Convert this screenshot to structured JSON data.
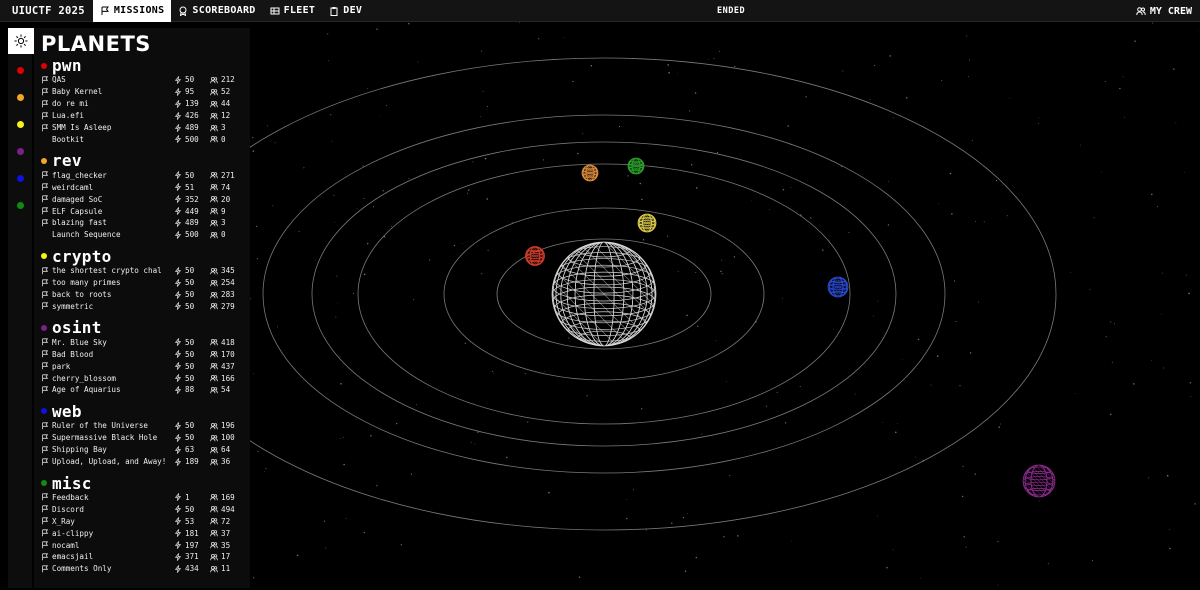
{
  "topbar": {
    "brand": "UIUCTF 2025",
    "nav": [
      {
        "label": "MISSIONS",
        "icon": "flag-icon",
        "active": true
      },
      {
        "label": "SCOREBOARD",
        "icon": "badge-icon",
        "active": false
      },
      {
        "label": "FLEET",
        "icon": "grid-icon",
        "active": false
      },
      {
        "label": "DEV",
        "icon": "clipboard-icon",
        "active": false
      }
    ],
    "status": "ENDED",
    "crew_label": "MY CREW"
  },
  "rail": {
    "toggle_icon": "sun-icon",
    "category_dots": [
      "#e00000",
      "#f5a623",
      "#f7f21a",
      "#7d1f8a",
      "#1010e0",
      "#128a12"
    ]
  },
  "panel": {
    "title": "PLANETS",
    "categories": [
      {
        "name": "pwn",
        "color": "#e00000",
        "challenges": [
          {
            "name": "QAS",
            "points": "50",
            "solves": "212",
            "flag": true
          },
          {
            "name": "Baby Kernel",
            "points": "95",
            "solves": "52",
            "flag": true
          },
          {
            "name": "do re mi",
            "points": "139",
            "solves": "44",
            "flag": true
          },
          {
            "name": "Lua.efi",
            "points": "426",
            "solves": "12",
            "flag": true
          },
          {
            "name": "SMM Is Asleep",
            "points": "489",
            "solves": "3",
            "flag": true
          },
          {
            "name": "Bootkit",
            "points": "500",
            "solves": "0",
            "flag": false
          }
        ]
      },
      {
        "name": "rev",
        "color": "#f5a623",
        "challenges": [
          {
            "name": "flag_checker",
            "points": "50",
            "solves": "271",
            "flag": true
          },
          {
            "name": "weirdcaml",
            "points": "51",
            "solves": "74",
            "flag": true
          },
          {
            "name": "damaged SoC",
            "points": "352",
            "solves": "20",
            "flag": true
          },
          {
            "name": "ELF Capsule",
            "points": "449",
            "solves": "9",
            "flag": true
          },
          {
            "name": "blazing fast",
            "points": "489",
            "solves": "3",
            "flag": true
          },
          {
            "name": "Launch Sequence",
            "points": "500",
            "solves": "0",
            "flag": false
          }
        ]
      },
      {
        "name": "crypto",
        "color": "#f7f21a",
        "challenges": [
          {
            "name": "the shortest crypto chal",
            "points": "50",
            "solves": "345",
            "flag": true
          },
          {
            "name": "too many primes",
            "points": "50",
            "solves": "254",
            "flag": true
          },
          {
            "name": "back to roots",
            "points": "50",
            "solves": "283",
            "flag": true
          },
          {
            "name": "symmetric",
            "points": "50",
            "solves": "279",
            "flag": true
          }
        ]
      },
      {
        "name": "osint",
        "color": "#7d1f8a",
        "challenges": [
          {
            "name": "Mr. Blue Sky",
            "points": "50",
            "solves": "418",
            "flag": true
          },
          {
            "name": "Bad Blood",
            "points": "50",
            "solves": "170",
            "flag": true
          },
          {
            "name": "park",
            "points": "50",
            "solves": "437",
            "flag": true
          },
          {
            "name": "cherry_blossom",
            "points": "50",
            "solves": "166",
            "flag": true
          },
          {
            "name": "Age of Aquarius",
            "points": "88",
            "solves": "54",
            "flag": true
          }
        ]
      },
      {
        "name": "web",
        "color": "#1010e0",
        "challenges": [
          {
            "name": "Ruler of the Universe",
            "points": "50",
            "solves": "196",
            "flag": true
          },
          {
            "name": "Supermassive Black Hole",
            "points": "50",
            "solves": "100",
            "flag": true
          },
          {
            "name": "Shipping Bay",
            "points": "63",
            "solves": "64",
            "flag": true
          },
          {
            "name": "Upload, Upload, and Away!",
            "points": "189",
            "solves": "36",
            "flag": true
          }
        ]
      },
      {
        "name": "misc",
        "color": "#128a12",
        "challenges": [
          {
            "name": "Feedback",
            "points": "1",
            "solves": "169",
            "flag": true
          },
          {
            "name": "Discord",
            "points": "50",
            "solves": "494",
            "flag": true
          },
          {
            "name": "X_Ray",
            "points": "53",
            "solves": "72",
            "flag": true
          },
          {
            "name": "ai-clippy",
            "points": "181",
            "solves": "37",
            "flag": true
          },
          {
            "name": "nocaml",
            "points": "197",
            "solves": "35",
            "flag": true
          },
          {
            "name": "emacsjail",
            "points": "371",
            "solves": "17",
            "flag": true
          },
          {
            "name": "Comments Only",
            "points": "434",
            "solves": "11",
            "flag": true
          }
        ]
      }
    ]
  },
  "scene": {
    "planet_colors": {
      "sun": "#d8d8d8",
      "pwn": "#d23b2a",
      "rev": "#d98a3a",
      "crypto": "#d8c84a",
      "osint": "#8a2a8a",
      "web": "#2a4ad0",
      "misc": "#2aa02a"
    }
  }
}
